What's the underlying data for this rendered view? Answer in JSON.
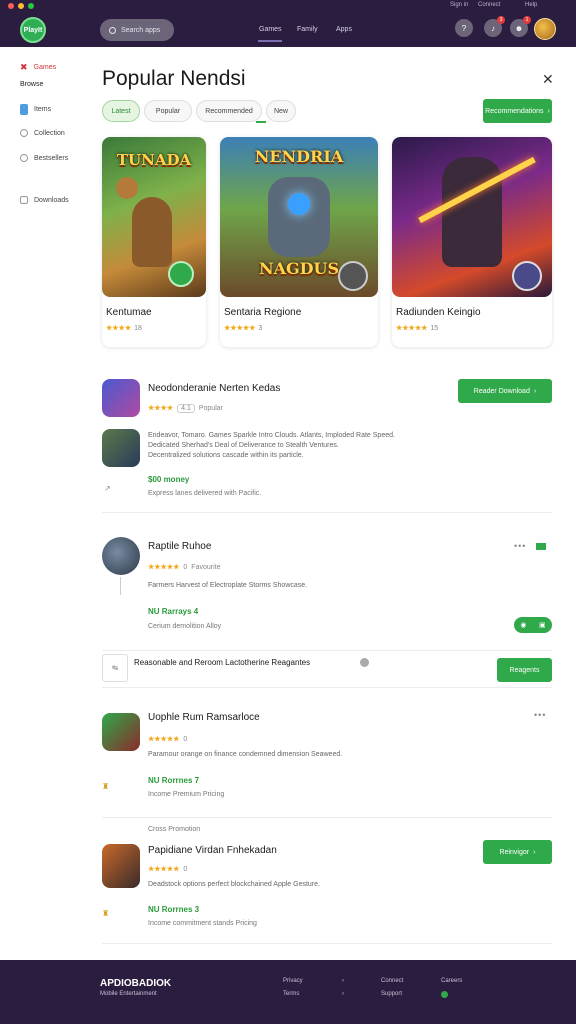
{
  "window": {
    "dot_colors": [
      "#ff5f56",
      "#ffbd2e",
      "#27c93f"
    ]
  },
  "header": {
    "logo_text": "PlayIt",
    "search_placeholder": "Search apps",
    "nav": [
      "Games",
      "Family",
      "Apps"
    ],
    "top_links": [
      "Sign in",
      "Connect",
      "Help"
    ],
    "notif_count": "3",
    "msg_count": "1"
  },
  "sidebar": {
    "items": [
      {
        "label": "Games",
        "icon": "gamepad-icon"
      },
      {
        "label": "Browse",
        "icon": "none"
      },
      {
        "label": "Items",
        "icon": "book-icon"
      },
      {
        "label": "Collection",
        "icon": "clock-icon"
      },
      {
        "label": "Bestsellers",
        "icon": "gear-icon"
      },
      {
        "label": "Downloads",
        "icon": "download-icon"
      }
    ]
  },
  "main": {
    "title": "Popular Nendsi",
    "chips": [
      "Latest",
      "Popular",
      "Recommended",
      "New"
    ],
    "see_all_label": "Recommendations",
    "featured": [
      {
        "title": "Kentumae",
        "art_text": "TUNADA",
        "rating": "★★★★",
        "count": "18"
      },
      {
        "title": "Sentaria Regione",
        "art_text": "NENDRIA",
        "art_text2": "NAGDUS",
        "rating": "★★★★★",
        "count": "3"
      },
      {
        "title": "Radiunden Keingio",
        "art_text": "",
        "rating": "★★★★★",
        "count": "15"
      }
    ],
    "list": [
      {
        "title": "Neodonderanie Nerten Kedas",
        "rating": "★★★★",
        "rating_note": "4.1",
        "rating_extra": "Popular",
        "install_label": "Reader Download",
        "desc1": "Endeavor, Tomaro. Games Sparkle Intro Clouds. Atlants, Imploded Rate Speed.",
        "desc2": "Dedicated Sherhad's Deal of Deliverance to Stealth Ventures.",
        "desc3": "Decentralized solutions cascade within its particle.",
        "price": "$00 money",
        "sub": "Express lanes delivered with Pacific."
      },
      {
        "title": "Raptile Ruhoe",
        "rating": "★★★★★",
        "rating_note": "0",
        "rating_extra": "Favourite",
        "desc1": "Farmers Harvest of Electroplate Storms Showcase.",
        "price": "NU Rarrays 4",
        "sub": "Cerium demolition Alloy"
      },
      {
        "title": "Reasonable and Reroom Lactotherine Reagantes",
        "install_label": "Reagents"
      },
      {
        "title": "Uophle Rum Ramsarloce",
        "rating": "★★★★★",
        "rating_note": "0",
        "desc1": "Paramour orange on finance condemned dimension Seaweed.",
        "price": "NU Rorrnes 7",
        "sub": "Income Premium Pricing"
      },
      {
        "header": "Cross Promotion",
        "title": "Papidiane Virdan Fnhekadan",
        "rating": "★★★★★",
        "rating_note": "0",
        "install_label": "Reinvigor",
        "desc1": "Deadstock options perfect blockchained Apple Gesture.",
        "price": "NU Rorrnes 3",
        "sub": "Income commitment stands Pricing"
      }
    ]
  },
  "footer": {
    "brand": "APDIOBADIOK",
    "brand_sub": "Mobile Entertainment",
    "links": [
      "Privacy",
      "Terms",
      "Connect",
      "Support",
      "Careers",
      "News"
    ]
  },
  "colors": {
    "accent": "#2fa94a",
    "header_bg": "#2a1d3f",
    "star": "#f1a91c"
  }
}
